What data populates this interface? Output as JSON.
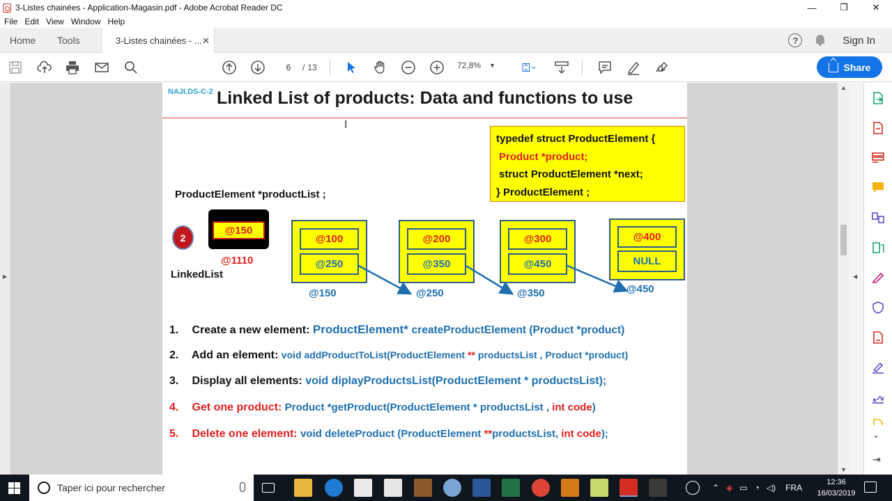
{
  "window": {
    "title": "3-Listes chainées - Application-Magasin.pdf - Adobe Acrobat Reader DC",
    "controls": [
      "—",
      "❐",
      "✕"
    ]
  },
  "menu": [
    "File",
    "Edit",
    "View",
    "Window",
    "Help"
  ],
  "tabs": {
    "home": "Home",
    "tools": "Tools",
    "document": "3-Listes chainées - ...",
    "close": "✕",
    "signin": "Sign In",
    "help": "?"
  },
  "toolbar": {
    "page_current": "6",
    "page_sep": "/",
    "page_total": "13",
    "zoom": "72,8%",
    "share": "Share"
  },
  "slide": {
    "tag": "NAJI.DS-C-2",
    "title": "Linked List of products: Data and functions to use",
    "typedef": [
      "typedef struct ProductElement {",
      "Product *product;",
      "struct ProductElement *next;",
      "} ProductElement ;"
    ],
    "product_list_decl": "ProductElement *productList ;",
    "circle_num": "2",
    "head_value": "@150",
    "head_address": "@1110",
    "linked_list_label": "LinkedList",
    "nodes": [
      {
        "data": "@100",
        "next": "@250",
        "address": "@150"
      },
      {
        "data": "@200",
        "next": "@350",
        "address": "@250"
      },
      {
        "data": "@300",
        "next": "@450",
        "address": "@350"
      },
      {
        "data": "@400",
        "next": "NULL",
        "address": "@450"
      }
    ],
    "items": [
      {
        "num": "1.",
        "label": "Create a new element:",
        "sig": "ProductElement* ",
        "sig2": "createProductElement (Product *product)"
      },
      {
        "num": "2.",
        "label": "Add an element:",
        "sig": "void addProductToList(ProductElement ",
        "red": "**",
        "sig2": " productsList , Product *product)"
      },
      {
        "num": "3.",
        "label": "Display all elements:",
        "sig": "void diplayProductsList(ProductElement * productsList);"
      },
      {
        "num": "4.",
        "label": "Get one product:",
        "sig": "Product *getProduct(ProductElement * productsList , ",
        "red": "int code",
        "sig2": ")"
      },
      {
        "num": "5.",
        "label": "Delete one element:",
        "sig": "void deleteProduct (ProductElement ",
        "red": "**",
        "sig2": "productsList, ",
        "red2": "int code",
        "sig3": ");"
      }
    ]
  },
  "taskbar": {
    "search_placeholder": "Taper ici pour rechercher",
    "lang": "FRA",
    "time": "12:36",
    "date": "16/03/2019"
  }
}
